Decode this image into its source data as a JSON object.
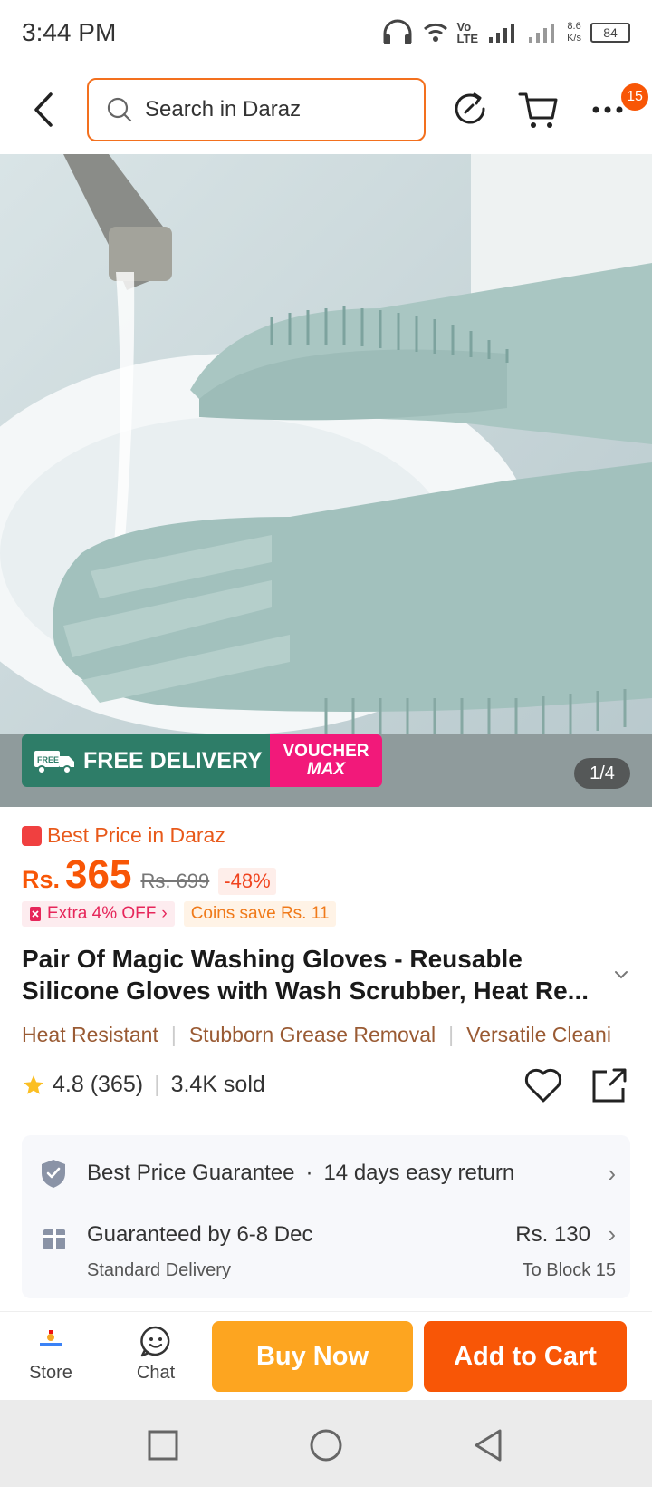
{
  "status_bar": {
    "time": "3:44 PM",
    "network_speed": "8.6",
    "network_unit": "K/s",
    "volte": "Vo",
    "lte": "LTE",
    "battery": "84"
  },
  "topnav": {
    "search_placeholder": "Search in Daraz",
    "cart_badge": "15",
    "more_label": "···"
  },
  "image": {
    "counter": "1/4",
    "delivery_free": "FREE",
    "delivery_label": "FREE DELIVERY",
    "voucher_top": "VOUCHER",
    "voucher_bottom": "MAX"
  },
  "product": {
    "best_price": "Best Price in Daraz",
    "currency": "Rs.",
    "price": "365",
    "old_price": "Rs. 699",
    "discount": "-48%",
    "promo_extra": "Extra 4% OFF",
    "promo_coins": "Coins save Rs. 11",
    "title": "Pair Of  Magic Washing Gloves - Reusable Silicone Gloves with Wash Scrubber, Heat Re...",
    "tags": [
      "Heat Resistant",
      "Stubborn Grease Removal",
      "Versatile Cleani"
    ],
    "rating": "4.8 (365)",
    "sold": "3.4K sold"
  },
  "service": {
    "guarantee": "Best Price Guarantee",
    "dot": "·",
    "returns": "14 days easy return",
    "delivery_date": "Guaranteed by 6-8 Dec",
    "delivery_type": "Standard Delivery",
    "delivery_fee": "Rs. 130",
    "delivery_to": "To Block 15"
  },
  "bottom": {
    "store": "Store",
    "chat": "Chat",
    "buy_now": "Buy Now",
    "add_to_cart": "Add to Cart"
  },
  "colors": {
    "accent": "#f85606",
    "buy_now": "#fda520",
    "delivery_green": "#2e7d68",
    "voucher_pink": "#f2197a"
  }
}
